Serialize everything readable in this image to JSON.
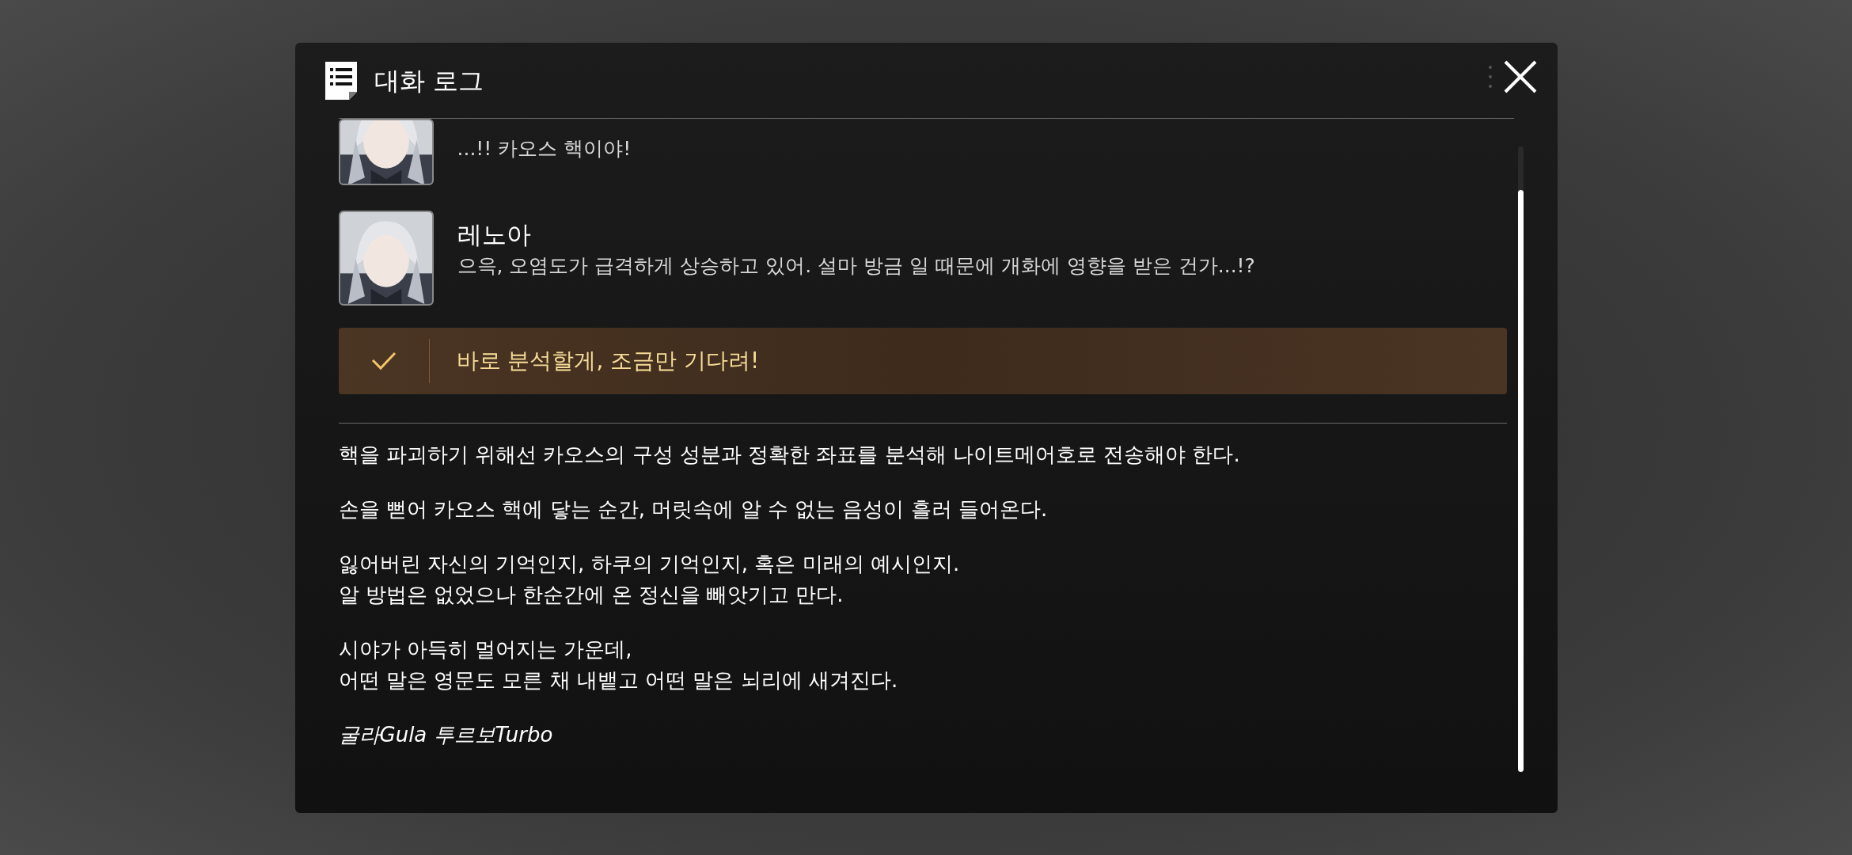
{
  "window": {
    "title": "대화 로그"
  },
  "entries": [
    {
      "kind": "line",
      "text": "...!! 카오스 핵이야!"
    },
    {
      "kind": "line",
      "speaker": "레노아",
      "text": "으윽, 오염도가 급격하게 상승하고 있어. 설마 방금 일 때문에 개화에 영향을 받은 건가...!?"
    },
    {
      "kind": "choice",
      "text": "바로 분석할게, 조금만 기다려!",
      "selected": true
    }
  ],
  "narration": [
    {
      "kind": "plain",
      "lines": [
        "핵을 파괴하기 위해선 카오스의 구성 성분과 정확한 좌표를 분석해 나이트메어호로 전송해야 한다."
      ]
    },
    {
      "kind": "plain",
      "lines": [
        "손을 뻗어 카오스 핵에 닿는 순간, 머릿속에 알 수 없는 음성이 흘러 들어온다."
      ]
    },
    {
      "kind": "plain",
      "lines": [
        "잃어버린 자신의 기억인지, 하쿠의 기억인지, 혹은 미래의 예시인지.",
        "알 방법은 없었으나 한순간에 온 정신을 빼앗기고 만다."
      ]
    },
    {
      "kind": "plain",
      "lines": [
        "시야가 아득히 멀어지는 가운데,",
        "어떤 말은 영문도 모른 채 내뱉고 어떤 말은 뇌리에 새겨진다."
      ]
    },
    {
      "kind": "signature",
      "lines": [
        "굴라Gula 투르보Turbo"
      ]
    }
  ]
}
